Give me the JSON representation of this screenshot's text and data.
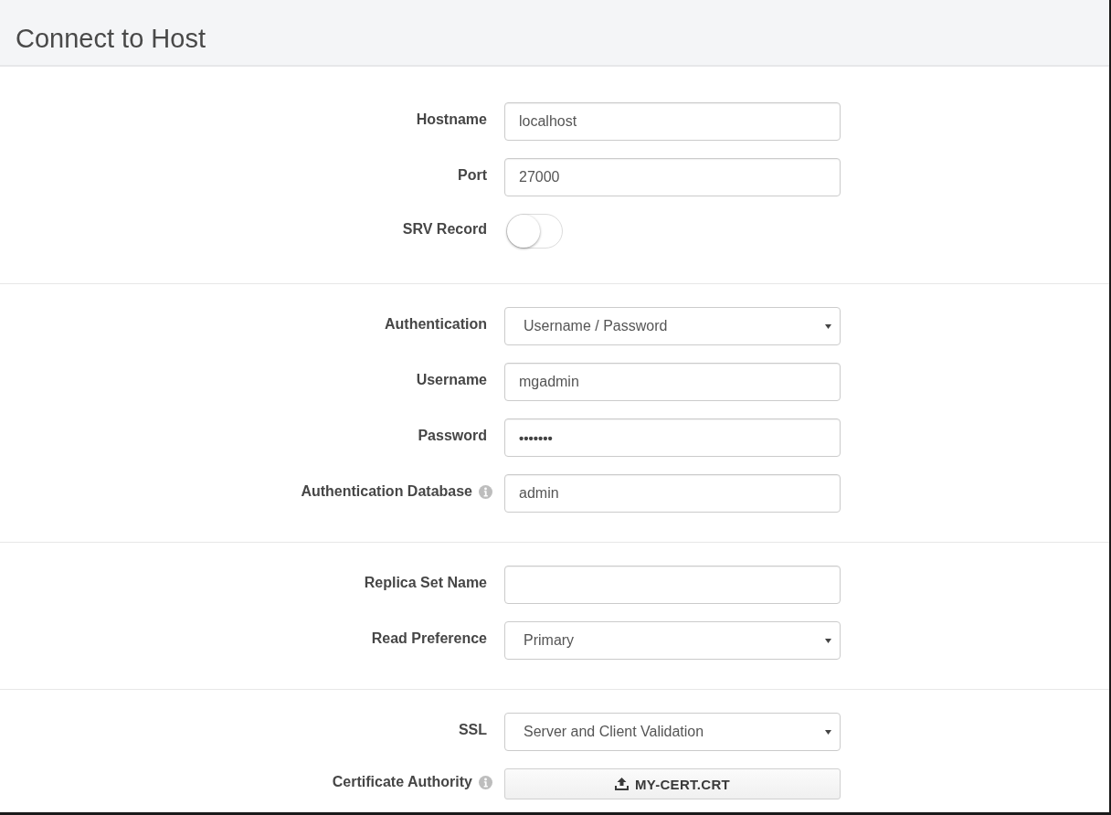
{
  "header": {
    "title": "Connect to Host"
  },
  "sections": [
    {
      "fields": [
        {
          "kind": "text",
          "label": "Hostname",
          "info": false,
          "value": "localhost"
        },
        {
          "kind": "text",
          "label": "Port",
          "info": false,
          "value": "27000"
        },
        {
          "kind": "toggle",
          "label": "SRV Record",
          "info": false,
          "on": false
        }
      ]
    },
    {
      "fields": [
        {
          "kind": "select",
          "label": "Authentication",
          "info": false,
          "value": "Username / Password"
        },
        {
          "kind": "text",
          "label": "Username",
          "info": false,
          "value": "mgadmin"
        },
        {
          "kind": "password",
          "label": "Password",
          "info": false,
          "value": "•••••••"
        },
        {
          "kind": "text",
          "label": "Authentication Database",
          "info": true,
          "value": "admin"
        }
      ]
    },
    {
      "fields": [
        {
          "kind": "text",
          "label": "Replica Set Name",
          "info": false
        },
        {
          "kind": "select",
          "label": "Read Preference",
          "info": false,
          "value": "Primary"
        }
      ]
    },
    {
      "fields": [
        {
          "kind": "select",
          "label": "SSL",
          "info": false,
          "value": "Server and Client Validation"
        },
        {
          "kind": "file",
          "label": "Certificate Authority",
          "info": true,
          "value": "MY-CERT.CRT"
        }
      ]
    }
  ]
}
